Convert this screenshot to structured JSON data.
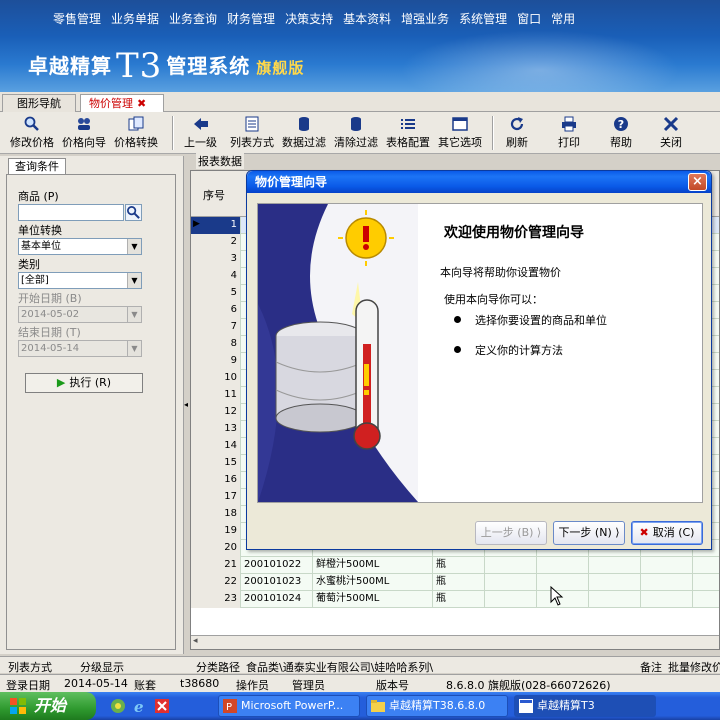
{
  "menu": [
    "零售管理",
    "业务单据",
    "业务查询",
    "财务管理",
    "决策支持",
    "基本资料",
    "增强业务",
    "系统管理",
    "窗口",
    "常用"
  ],
  "logo": {
    "name": "卓越精算",
    "t3": "T3",
    "system": "管理系统",
    "edition": "旗舰版"
  },
  "tabs": [
    {
      "label": "图形导航"
    },
    {
      "label": "物价管理",
      "close": "✖"
    }
  ],
  "toolbar": {
    "modify_price": "修改价格",
    "price_wizard": "价格向导",
    "price_convert": "价格转换",
    "up_level": "上一级",
    "list_mode": "列表方式",
    "data_filter": "数据过滤",
    "clear_filter": "清除过滤",
    "table_config": "表格配置",
    "other_options": "其它选项",
    "refresh": "刷新",
    "print": "打印",
    "help": "帮助",
    "close": "关闭"
  },
  "query": {
    "tab": "查询条件",
    "product_label": "商品 (P)",
    "unit_label": "单位转换",
    "unit_value": "基本单位",
    "category_label": "类别",
    "category_value": "[全部]",
    "start_label": "开始日期 (B)",
    "start_value": "2014-05-02",
    "end_label": "结束日期 (T)",
    "end_value": "2014-05-14",
    "execute": "执行 (R)"
  },
  "grid": {
    "label": "报表数据",
    "col_seq": "序号",
    "rows": [
      {
        "n": "1"
      },
      {
        "n": "2"
      },
      {
        "n": "3"
      },
      {
        "n": "4"
      },
      {
        "n": "5"
      },
      {
        "n": "6"
      },
      {
        "n": "7"
      },
      {
        "n": "8"
      },
      {
        "n": "9"
      },
      {
        "n": "10"
      },
      {
        "n": "11"
      },
      {
        "n": "12"
      },
      {
        "n": "13"
      },
      {
        "n": "14"
      },
      {
        "n": "15"
      },
      {
        "n": "16"
      },
      {
        "n": "17"
      },
      {
        "n": "18"
      },
      {
        "n": "19"
      },
      {
        "n": "20"
      },
      {
        "n": "21",
        "code": "200101022",
        "name": "鲜橙汁500ML",
        "unit": "瓶"
      },
      {
        "n": "22",
        "code": "200101023",
        "name": "水蜜桃汁500ML",
        "unit": "瓶"
      },
      {
        "n": "23",
        "code": "200101024",
        "name": "葡萄汁500ML",
        "unit": "瓶"
      }
    ]
  },
  "status1": {
    "list_mode": "列表方式",
    "level_display": "分级显示",
    "path_label": "分类路径",
    "path_value": "食品类\\通泰实业有限公司\\娃哈哈系列\\",
    "remark": "备注",
    "batch": "批量修改价"
  },
  "status2": {
    "login_label": "登录日期",
    "login_value": "2014-05-14",
    "account_label": "账套",
    "account_value": "t38680",
    "operator_label": "操作员",
    "operator_value": "管理员",
    "version_label": "版本号",
    "version_value": "8.6.8.0 旗舰版(028-66072626)"
  },
  "taskbar": {
    "start": "开始",
    "items": [
      "Microsoft PowerP...",
      "卓越精算T38.6.8.0",
      "卓越精算T3"
    ]
  },
  "dialog": {
    "title": "物价管理向导",
    "heading": "欢迎使用物价管理向导",
    "desc": "本向导将帮助你设置物价",
    "usage": "使用本向导你可以：",
    "bullets": [
      "选择你要设置的商品和单位",
      "定义你的计算方法"
    ],
    "prev": "上一步 (B) ⟩",
    "next": "下一步 (N) ⟩",
    "cancel": "取消 (C)"
  }
}
